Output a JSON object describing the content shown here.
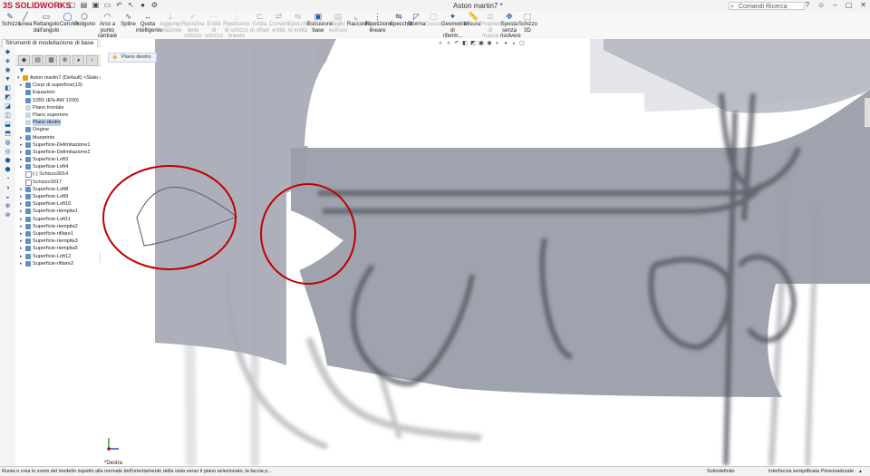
{
  "app": {
    "logo_text": "SOLIDWORKS",
    "logo_prefix": "3S",
    "doc_title": "Aston martin7 *"
  },
  "search": {
    "placeholder": "Comandi Ricerca"
  },
  "ribbon": {
    "buttons": [
      {
        "label": "Schizzo",
        "icon": "sketch-icon"
      },
      {
        "label": "Linea",
        "icon": "line-icon"
      },
      {
        "label": "Rettangolo dall'angolo",
        "icon": "rectangle-icon"
      },
      {
        "label": "Cerchio",
        "icon": "circle-icon"
      },
      {
        "label": "Poligono",
        "icon": "polygon-icon"
      },
      {
        "label": "Arco a punto centrale",
        "icon": "arc-icon"
      },
      {
        "label": "Spline",
        "icon": "spline-icon"
      },
      {
        "label": "Quota intelligente",
        "icon": "dimension-icon"
      },
      {
        "label": "Aggiungi relazione",
        "icon": "relation-icon"
      },
      {
        "label": "Ripristina dello schizzo",
        "icon": "repair-icon"
      },
      {
        "label": "Entità di schizzo",
        "icon": "entities-icon"
      },
      {
        "label": "Ripetizione di schizzo lineare",
        "icon": "pattern-icon"
      },
      {
        "label": "Entità di offset",
        "icon": "offset-icon"
      },
      {
        "label": "Converti entità",
        "icon": "convert-icon"
      },
      {
        "label": "Specchia le entità",
        "icon": "mirror-icon"
      },
      {
        "label": "Estrusione base",
        "icon": "extrude-icon"
      },
      {
        "label": "Taglio estruso",
        "icon": "cut-icon"
      },
      {
        "label": "Raccordo",
        "icon": "fillet-icon"
      },
      {
        "label": "Ripetizione lineare",
        "icon": "linear-pattern-icon"
      },
      {
        "label": "Specchia",
        "icon": "mirror-feature-icon"
      },
      {
        "label": "Sforma",
        "icon": "draft-icon"
      },
      {
        "label": "Guscio",
        "icon": "shell-icon"
      },
      {
        "label": "Geometria di riferim...",
        "icon": "reference-icon"
      },
      {
        "label": "Misura",
        "icon": "measure-icon"
      },
      {
        "label": "Proprietà di massa",
        "icon": "mass-icon"
      },
      {
        "label": "Sposta senza risolvere",
        "icon": "move-icon"
      },
      {
        "label": "Schizzo 3D",
        "icon": "sketch3d-icon"
      }
    ],
    "tab_label": "Strumenti di modellazione di base"
  },
  "tree": {
    "items": [
      {
        "label": "Aston martin7 (Default) <Stato di vis",
        "level": 0,
        "expand": "▾"
      },
      {
        "label": "Corpi di superficie(13)",
        "level": 1,
        "expand": "▸"
      },
      {
        "label": "Equazioni",
        "level": 1,
        "expand": ""
      },
      {
        "label": "S355 (EN-AW 1200)",
        "level": 1,
        "expand": ""
      },
      {
        "label": "Piano frontale",
        "level": 1,
        "expand": ""
      },
      {
        "label": "Piano superiore",
        "level": 1,
        "expand": ""
      },
      {
        "label": "Piano destro",
        "level": 1,
        "expand": "",
        "selected": true
      },
      {
        "label": "Origine",
        "level": 1,
        "expand": ""
      },
      {
        "label": "blueprints",
        "level": 1,
        "expand": "▸"
      },
      {
        "label": "Superficie-Delimitazione1",
        "level": 1,
        "expand": "▸"
      },
      {
        "label": "Superficie-Delimitazione2",
        "level": 1,
        "expand": "▸"
      },
      {
        "label": "Superficie-Loft3",
        "level": 1,
        "expand": "▸"
      },
      {
        "label": "Superficie-Loft4",
        "level": 1,
        "expand": "▸"
      },
      {
        "label": "(-) Schizzo3014",
        "level": 1,
        "expand": ""
      },
      {
        "label": "Schizzo3017",
        "level": 1,
        "expand": ""
      },
      {
        "label": "Superficie-Loft8",
        "level": 1,
        "expand": "▸"
      },
      {
        "label": "Superficie-Loft9",
        "level": 1,
        "expand": "▸"
      },
      {
        "label": "Superficie-Loft10",
        "level": 1,
        "expand": "▸"
      },
      {
        "label": "Superficie-riempita1",
        "level": 1,
        "expand": "▸"
      },
      {
        "label": "Superficie-Loft11",
        "level": 1,
        "expand": "▸"
      },
      {
        "label": "Superficie-riempita2",
        "level": 1,
        "expand": "▸"
      },
      {
        "label": "Superficie-rifilare1",
        "level": 1,
        "expand": "▸"
      },
      {
        "label": "Superficie-riempita3",
        "level": 1,
        "expand": "▸"
      },
      {
        "label": "Superficie-riempita5",
        "level": 1,
        "expand": "▸"
      },
      {
        "label": "Superficie-Loft12",
        "level": 1,
        "expand": "▸"
      },
      {
        "label": "Superficie-rifilare2",
        "level": 1,
        "expand": "▸"
      }
    ]
  },
  "viewport": {
    "tab_label": "Piano destro",
    "view_name": "*Destra"
  },
  "status": {
    "message": "Ruota e crea lo zoom del modello rispetto alla normale dell'orientamento della vista verso il piano selezionato, la faccia p...",
    "state": "Sottodefinito",
    "mode": "Interfaccia semplificata",
    "custom": "Personalizzate",
    "extra": "▴"
  }
}
